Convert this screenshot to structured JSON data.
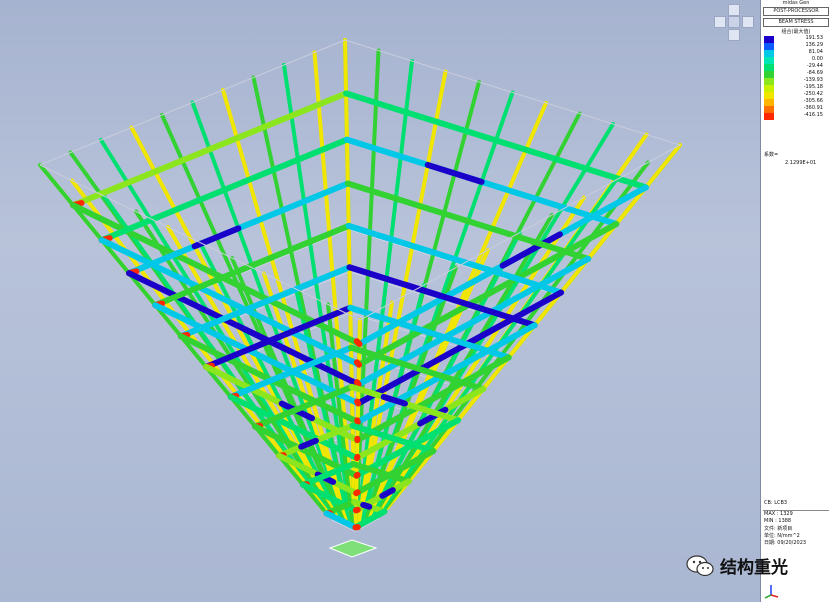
{
  "panel": {
    "app_name": "midas Gen",
    "mode": "POST-PROCESSOR",
    "result_type": "BEAM STRESS",
    "unit_title": "组合(最大值)",
    "legend_values": [
      "191.53",
      "136.29",
      "81.04",
      "0.00",
      "-29.44",
      "-84.69",
      "-139.93",
      "-195.18",
      "-250.42",
      "-305.66",
      "-360.91",
      "-416.15"
    ],
    "legend_colors": [
      "#1a00c8",
      "#0a5cff",
      "#00c8e6",
      "#00e6b4",
      "#00e070",
      "#32d232",
      "#8ce61e",
      "#c8f000",
      "#f0e600",
      "#ffb400",
      "#ff6e00",
      "#ff2800"
    ],
    "scale_label": "系数=",
    "scale_value": "2.1299E+01",
    "load_case": "CB: LCB3",
    "max_label": "MAX : 1329",
    "min_label": "MIN : 1388",
    "file_label": "文件: 新项目",
    "unit_label": "单位: N/mm^2",
    "date_label": "日期: 09/20/2023"
  },
  "watermark": {
    "text": "结构重光"
  },
  "icons": {
    "nav": "view-navigation-cube-icon",
    "wechat": "wechat-icon",
    "axis": "axis-triad-icon"
  }
}
